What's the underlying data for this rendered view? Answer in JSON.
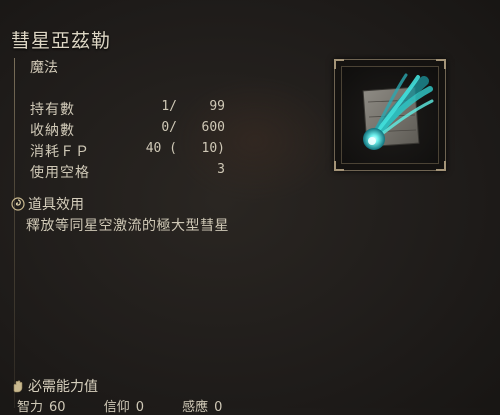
{
  "item": {
    "name": "彗星亞茲勒",
    "category": "魔法"
  },
  "stats": [
    {
      "label": "持有數",
      "v1": "1/",
      "v2": "99"
    },
    {
      "label": "收納數",
      "v1": "0/",
      "v2": "600"
    },
    {
      "label": "消耗ＦＰ",
      "v1": "40 (",
      "v2": "10)"
    },
    {
      "label": "使用空格",
      "v1": "",
      "v2": "3"
    }
  ],
  "effect": {
    "heading": "道具效用",
    "text": "釋放等同星空激流的極大型彗星",
    "icon": "swirl-icon"
  },
  "requirements": {
    "heading": "必需能力值",
    "icon": "hand-icon",
    "items": [
      {
        "label": "智力",
        "value": "60"
      },
      {
        "label": "信仰",
        "value": "0"
      },
      {
        "label": "感應",
        "value": "0"
      }
    ]
  },
  "colors": {
    "background": "#1f1c1a",
    "text": "#d6cfbd",
    "frame": "#6f6452",
    "comet": "#3fd6d2"
  },
  "icons": {
    "item_image": "comet-scroll-icon"
  }
}
